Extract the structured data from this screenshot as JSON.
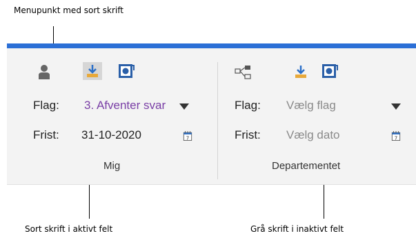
{
  "callouts": {
    "top": "Menupunkt med sort skrift",
    "bottom_left": "Sort skrift i aktivt felt",
    "bottom_right": "Grå skrift i inaktivt felt"
  },
  "groups": [
    {
      "name": "Mig",
      "flag_label": "Flag:",
      "flag_value": "3. Afventer svar",
      "due_label": "Frist:",
      "due_value": "31-10-2020"
    },
    {
      "name": "Departementet",
      "flag_label": "Flag:",
      "flag_value": "Vælg flag",
      "due_label": "Frist:",
      "due_value": "Vælg dato"
    }
  ],
  "icons": {
    "person": "person-icon",
    "download_tray": "download-tray-icon",
    "outlook_sync": "outlook-sync-icon",
    "org_chart": "org-chart-icon",
    "calendar": "calendar-icon"
  },
  "colors": {
    "ribbon_accent": "#2b6fd6",
    "flag_active": "#7a3fa6",
    "inactive_text": "#8a8a8a"
  }
}
